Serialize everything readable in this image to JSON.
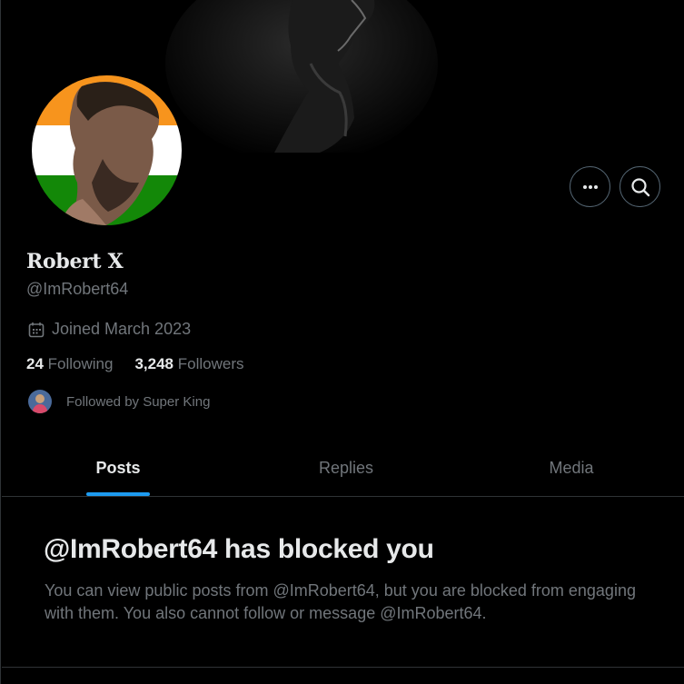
{
  "profile": {
    "display_name": "Robert X",
    "handle": "@ImRobert64",
    "joined": "Joined March 2023",
    "following_count": "24",
    "following_label": "Following",
    "followers_count": "3,248",
    "followers_label": "Followers",
    "followed_by": "Followed by Super King"
  },
  "header_actions": {
    "more_icon": "more-horizontal-icon",
    "search_icon": "search-icon"
  },
  "tabs": [
    {
      "label": "Posts",
      "active": true
    },
    {
      "label": "Replies",
      "active": false
    },
    {
      "label": "Media",
      "active": false
    }
  ],
  "blocked": {
    "title": "@ImRobert64 has blocked you",
    "message": "You can view public posts from @ImRobert64, but you are blocked from engaging with them. You also cannot follow or message @ImRobert64."
  },
  "colors": {
    "background": "#000000",
    "text_primary": "#e7e9ea",
    "text_secondary": "#71767b",
    "accent": "#1d9bf0",
    "border": "#2f3336",
    "flag_saffron": "#f7941d",
    "flag_white": "#ffffff",
    "flag_green": "#138808"
  }
}
